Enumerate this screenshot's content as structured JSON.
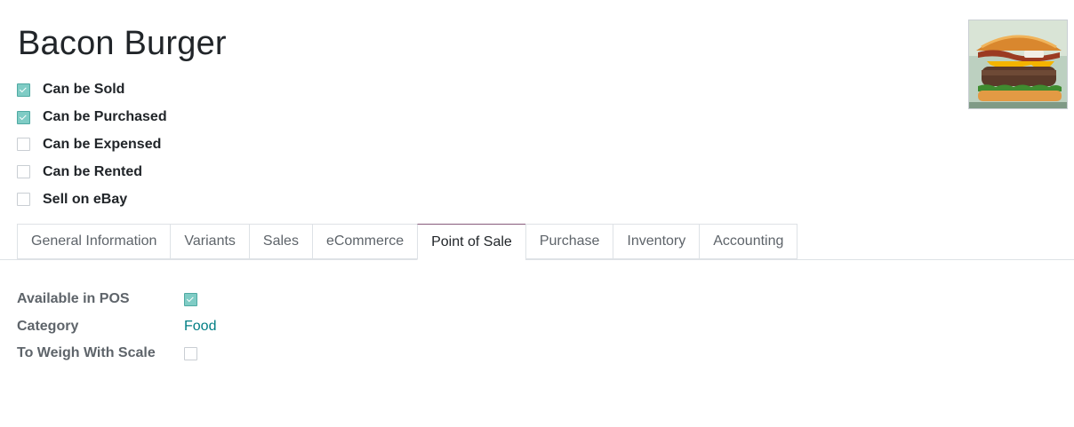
{
  "product": {
    "name": "Bacon Burger",
    "options": [
      {
        "label": "Can be Sold",
        "checked": true
      },
      {
        "label": "Can be Purchased",
        "checked": true
      },
      {
        "label": "Can be Expensed",
        "checked": false
      },
      {
        "label": "Can be Rented",
        "checked": false
      },
      {
        "label": "Sell on eBay",
        "checked": false
      }
    ]
  },
  "tabs": [
    {
      "label": "General Information"
    },
    {
      "label": "Variants"
    },
    {
      "label": "Sales"
    },
    {
      "label": "eCommerce"
    },
    {
      "label": "Point of Sale",
      "active": true
    },
    {
      "label": "Purchase"
    },
    {
      "label": "Inventory"
    },
    {
      "label": "Accounting"
    }
  ],
  "pos": {
    "available_label": "Available in POS",
    "available_checked": true,
    "category_label": "Category",
    "category_value": "Food",
    "weigh_label": "To Weigh With Scale",
    "weigh_checked": false
  },
  "colors": {
    "accent": "#017e84",
    "checkbox_checked": "#7fccc5",
    "active_tab_top": "#875a7b"
  }
}
